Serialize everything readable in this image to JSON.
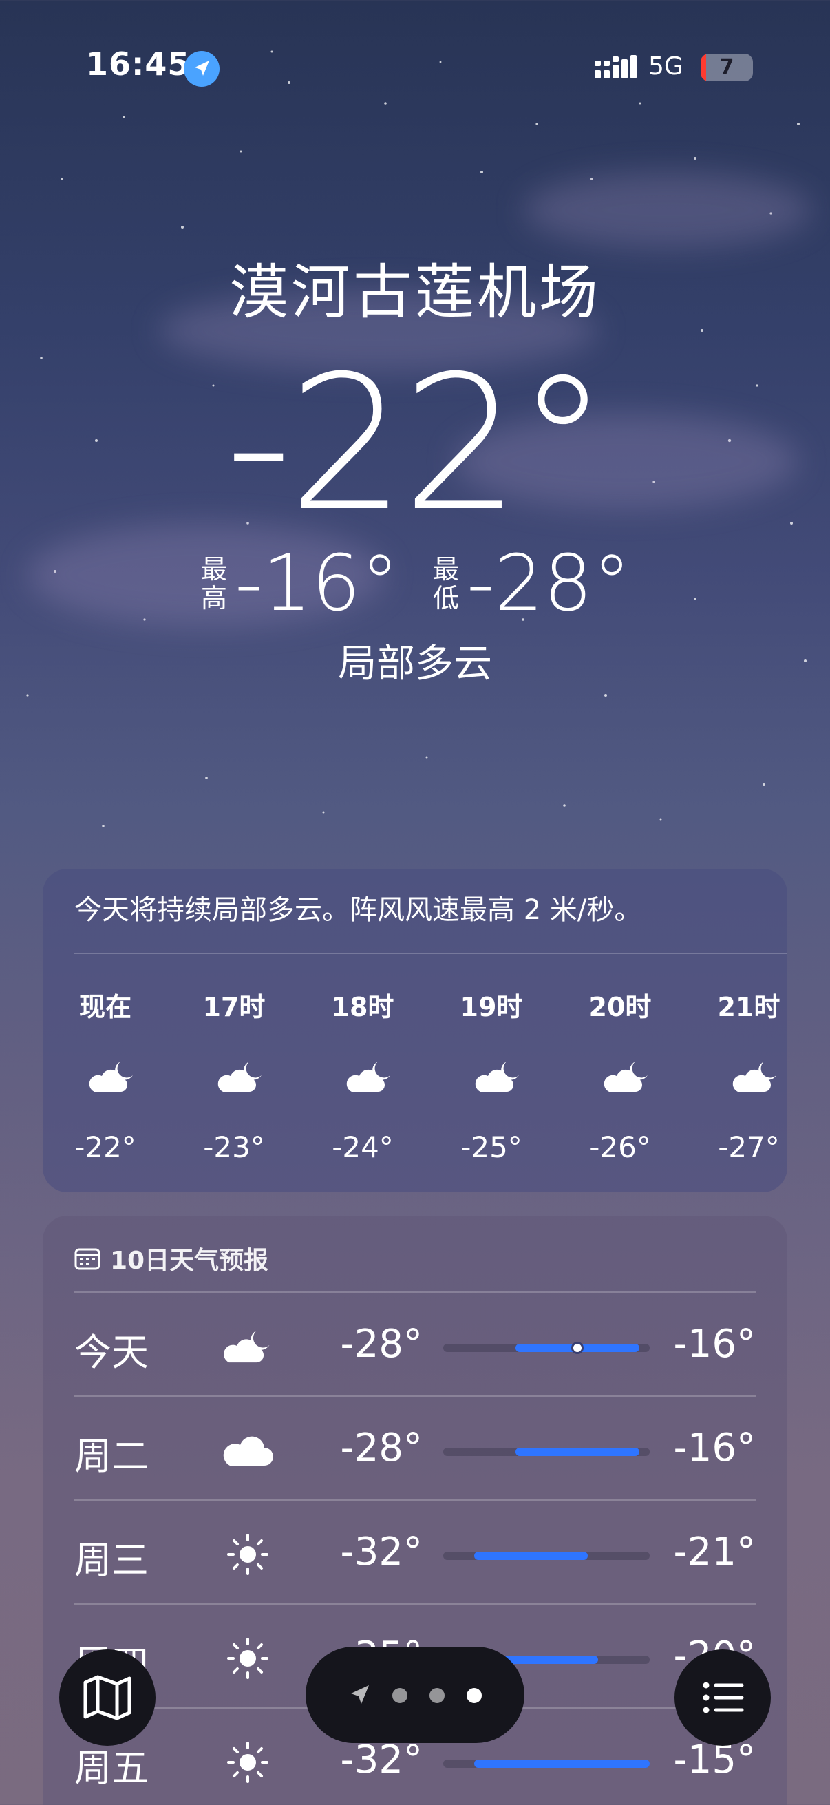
{
  "status_bar": {
    "time": "16:45",
    "network": "5G",
    "battery": "7",
    "location_icon": "location-arrow-icon",
    "signal_icon": "cellular-signal-icon"
  },
  "location": "漠河古莲机场",
  "current_temp": "-22°",
  "high_label": "最高",
  "high_value": "-16°",
  "low_label": "最低",
  "low_value": "-28°",
  "condition": "局部多云",
  "hourly": {
    "summary": "今天将持续局部多云。阵风风速最高 2 米/秒。",
    "hours": [
      {
        "label": "现在",
        "icon": "partly-cloudy-night-icon",
        "temp": "-22°"
      },
      {
        "label": "17时",
        "icon": "partly-cloudy-night-icon",
        "temp": "-23°"
      },
      {
        "label": "18时",
        "icon": "partly-cloudy-night-icon",
        "temp": "-24°"
      },
      {
        "label": "19时",
        "icon": "partly-cloudy-night-icon",
        "temp": "-25°"
      },
      {
        "label": "20时",
        "icon": "partly-cloudy-night-icon",
        "temp": "-26°"
      },
      {
        "label": "21时",
        "icon": "partly-cloudy-night-icon",
        "temp": "-27°"
      }
    ]
  },
  "ten_day": {
    "title": "10日天气预报",
    "scale": {
      "min": -35,
      "max": -15
    },
    "current_temp": -22,
    "days": [
      {
        "day": "今天",
        "icon": "partly-cloudy-night-icon",
        "low": "-28°",
        "high": "-16°"
      },
      {
        "day": "周二",
        "icon": "cloud-icon",
        "low": "-28°",
        "high": "-16°"
      },
      {
        "day": "周三",
        "icon": "sun-icon",
        "low": "-32°",
        "high": "-21°"
      },
      {
        "day": "周四",
        "icon": "sun-icon",
        "low": "-35°",
        "high": "-20°"
      },
      {
        "day": "周五",
        "icon": "sun-icon",
        "low": "-32°",
        "high": "-15°"
      }
    ]
  },
  "bottom_bar": {
    "map_icon": "map-icon",
    "list_icon": "list-icon",
    "page_count": 3,
    "active_page": 3
  },
  "colors": {
    "range_bar": "#2f75ff",
    "battery_low": "#ff3b30"
  }
}
